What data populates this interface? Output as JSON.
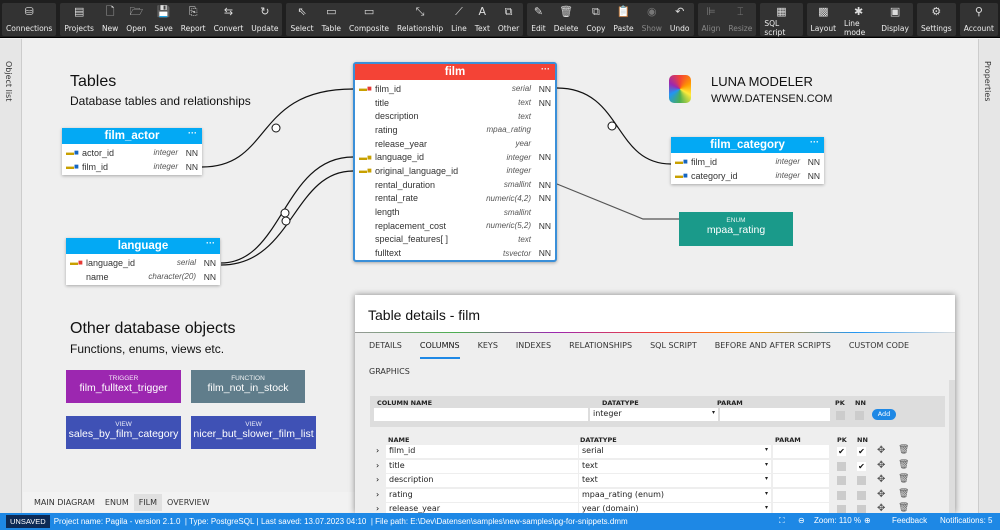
{
  "toolbar": {
    "groups": [
      [
        {
          "label": "Connections",
          "icon": "database-icon",
          "g": "⛁"
        }
      ],
      [
        {
          "label": "Projects",
          "icon": "projects-icon",
          "g": "▤"
        },
        {
          "label": "New",
          "icon": "new-file-icon",
          "g": "🗋"
        },
        {
          "label": "Open",
          "icon": "folder-open-icon",
          "g": "🗁"
        },
        {
          "label": "Save",
          "icon": "save-icon",
          "g": "💾"
        },
        {
          "label": "Report",
          "icon": "report-icon",
          "g": "⎘"
        },
        {
          "label": "Convert",
          "icon": "convert-icon",
          "g": "⇆"
        },
        {
          "label": "Update",
          "icon": "update-icon",
          "g": "↻"
        }
      ],
      [
        {
          "label": "Select",
          "icon": "cursor-icon",
          "g": "⇖"
        },
        {
          "label": "Table",
          "icon": "table-icon",
          "g": "▭"
        },
        {
          "label": "Composite",
          "icon": "composite-icon",
          "g": "▭"
        },
        {
          "label": "Relationship",
          "icon": "relationship-icon",
          "g": "⤡"
        },
        {
          "label": "Line",
          "icon": "line-icon",
          "g": "⟋"
        },
        {
          "label": "Text",
          "icon": "text-icon",
          "g": "A"
        },
        {
          "label": "Other",
          "icon": "other-icon",
          "g": "⧉"
        }
      ],
      [
        {
          "label": "Edit",
          "icon": "pencil-icon",
          "g": "✎"
        },
        {
          "label": "Delete",
          "icon": "trash-icon",
          "g": "🗑"
        },
        {
          "label": "Copy",
          "icon": "copy-icon",
          "g": "⧉"
        },
        {
          "label": "Paste",
          "icon": "paste-icon",
          "g": "📋"
        },
        {
          "label": "Show",
          "icon": "eye-icon",
          "g": "◉",
          "dim": true
        },
        {
          "label": "Undo",
          "icon": "undo-icon",
          "g": "↶"
        }
      ],
      [
        {
          "label": "Align",
          "icon": "align-icon",
          "g": "⊫",
          "dim": true
        },
        {
          "label": "Resize",
          "icon": "resize-icon",
          "g": "⌶",
          "dim": true
        }
      ],
      [
        {
          "label": "SQL script",
          "icon": "sql-script-icon",
          "g": "▦"
        }
      ],
      [
        {
          "label": "Layout",
          "icon": "layout-icon",
          "g": "▩"
        },
        {
          "label": "Line mode",
          "icon": "line-mode-icon",
          "g": "✱"
        },
        {
          "label": "Display",
          "icon": "display-icon",
          "g": "▣"
        }
      ],
      [
        {
          "label": "Settings",
          "icon": "gear-icon",
          "g": "⚙"
        }
      ],
      [
        {
          "label": "Account",
          "icon": "user-icon",
          "g": "⚲"
        }
      ]
    ]
  },
  "sidebars": {
    "left": "Object list",
    "right": "Properties"
  },
  "canvas": {
    "tables_title": "Tables",
    "tables_subtitle": "Database tables and relationships",
    "other_title": "Other database objects",
    "other_subtitle": "Functions, enums, views etc.",
    "logo": {
      "name": "LUNA MODELER",
      "url": "WWW.DATENSEN.COM"
    },
    "film": {
      "name": "film",
      "color": "#f44336",
      "columns": [
        {
          "name": "film_id",
          "type": "serial",
          "nn": "NN",
          "key": "pk"
        },
        {
          "name": "title",
          "type": "text",
          "nn": "NN"
        },
        {
          "name": "description",
          "type": "text",
          "nn": ""
        },
        {
          "name": "rating",
          "type": "mpaa_rating",
          "nn": ""
        },
        {
          "name": "release_year",
          "type": "year",
          "nn": ""
        },
        {
          "name": "language_id",
          "type": "integer",
          "nn": "NN",
          "key": "fk"
        },
        {
          "name": "original_language_id",
          "type": "integer",
          "nn": "",
          "key": "fk"
        },
        {
          "name": "rental_duration",
          "type": "smallint",
          "nn": "NN"
        },
        {
          "name": "rental_rate",
          "type": "numeric(4,2)",
          "nn": "NN"
        },
        {
          "name": "length",
          "type": "smallint",
          "nn": ""
        },
        {
          "name": "replacement_cost",
          "type": "numeric(5,2)",
          "nn": "NN"
        },
        {
          "name": "special_features[ ]",
          "type": "text",
          "nn": ""
        },
        {
          "name": "fulltext",
          "type": "tsvector",
          "nn": "NN"
        }
      ]
    },
    "film_actor": {
      "name": "film_actor",
      "color": "#03a9f4",
      "columns": [
        {
          "name": "actor_id",
          "type": "integer",
          "nn": "NN",
          "key": "pfk"
        },
        {
          "name": "film_id",
          "type": "integer",
          "nn": "NN",
          "key": "pfk"
        }
      ]
    },
    "language": {
      "name": "language",
      "color": "#03a9f4",
      "columns": [
        {
          "name": "language_id",
          "type": "serial",
          "nn": "NN",
          "key": "pk"
        },
        {
          "name": "name",
          "type": "character(20)",
          "nn": "NN"
        }
      ]
    },
    "film_category": {
      "name": "film_category",
      "color": "#03a9f4",
      "columns": [
        {
          "name": "film_id",
          "type": "integer",
          "nn": "NN",
          "key": "pfk"
        },
        {
          "name": "category_id",
          "type": "integer",
          "nn": "NN",
          "key": "pfk"
        }
      ]
    },
    "objects": [
      {
        "kind": "ENUM",
        "name": "mpaa_rating",
        "color": "#1a9a8a"
      },
      {
        "kind": "TRIGGER",
        "name": "film_fulltext_trigger",
        "color": "#9c27b0"
      },
      {
        "kind": "FUNCTION",
        "name": "film_not_in_stock",
        "color": "#607d8b"
      },
      {
        "kind": "VIEW",
        "name": "sales_by_film_category",
        "color": "#3f51b5"
      },
      {
        "kind": "VIEW",
        "name": "nicer_but_slower_film_list",
        "color": "#3f51b5"
      }
    ]
  },
  "bottom_tabs": [
    {
      "label": "MAIN DIAGRAM"
    },
    {
      "label": "ENUM"
    },
    {
      "label": "FILM",
      "active": true
    },
    {
      "label": "OVERVIEW"
    }
  ],
  "dialog": {
    "title": "Table details - film",
    "tabs": [
      {
        "label": "DETAILS"
      },
      {
        "label": "COLUMNS",
        "active": true
      },
      {
        "label": "KEYS"
      },
      {
        "label": "INDEXES"
      },
      {
        "label": "RELATIONSHIPS"
      },
      {
        "label": "SQL SCRIPT"
      },
      {
        "label": "BEFORE AND AFTER SCRIPTS"
      },
      {
        "label": "CUSTOM CODE"
      },
      {
        "label": "GRAPHICS"
      }
    ],
    "add": {
      "col_name_label": "COLUMN NAME",
      "datatype_label": "DATATYPE",
      "param_label": "PARAM",
      "pk_label": "PK",
      "nn_label": "NN",
      "col_name": "",
      "datatype": "integer",
      "param": "",
      "add_label": "Add"
    },
    "grid": {
      "headers": {
        "name": "NAME",
        "datatype": "DATATYPE",
        "param": "PARAM",
        "pk": "PK",
        "nn": "NN"
      },
      "rows": [
        {
          "name": "film_id",
          "datatype": "serial",
          "param": "",
          "pk": true,
          "nn": true
        },
        {
          "name": "title",
          "datatype": "text",
          "param": "",
          "pk": false,
          "nn": true
        },
        {
          "name": "description",
          "datatype": "text",
          "param": "",
          "pk": false,
          "nn": false
        },
        {
          "name": "rating",
          "datatype": "mpaa_rating (enum)",
          "param": "",
          "pk": false,
          "nn": false
        },
        {
          "name": "release_year",
          "datatype": "year (domain)",
          "param": "",
          "pk": false,
          "nn": false
        }
      ]
    }
  },
  "status": {
    "unsaved": "UNSAVED",
    "project": "Project name: Pagila - version 2.1.0",
    "type": "| Type: PostgreSQL",
    "saved": "| Last saved: 13.07.2023 04:10",
    "path": "| File path: E:\\Dev\\Datensen\\samples\\new-samples\\pg-for-snippets.dmm",
    "zoom": "Zoom: 110 %",
    "feedback": "Feedback",
    "notifications": "Notifications: 5"
  },
  "colors": {
    "accent": "#1e88e5",
    "toolbar": "#1f1f1f"
  }
}
